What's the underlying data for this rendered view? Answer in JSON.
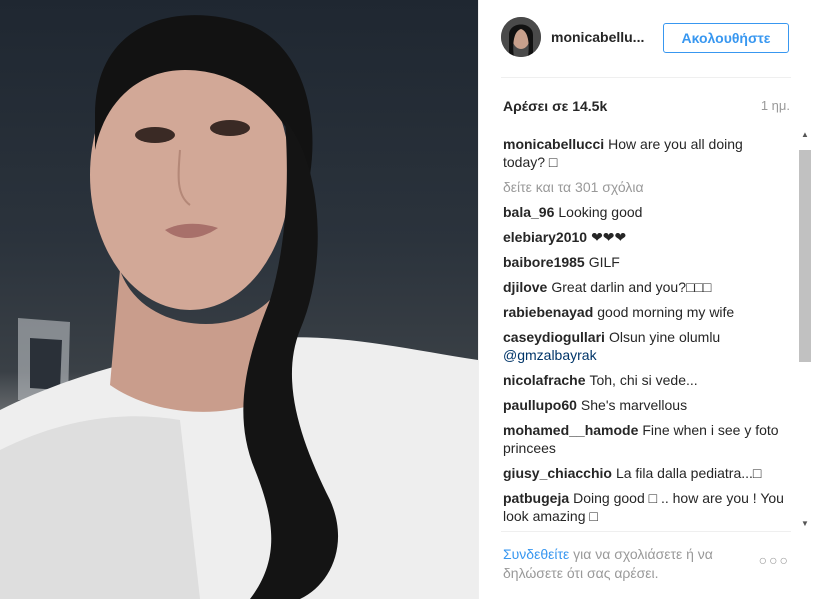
{
  "post": {
    "username": "monicabellu...",
    "follow_label": "Ακολουθήστε",
    "likes_label": "Αρέσει σε 14.5k",
    "time_ago": "1 ημ."
  },
  "comments": [
    {
      "user": "monicabellucci",
      "text": "How are you all doing today? □"
    },
    {
      "more": "δείτε και τα 301 σχόλια"
    },
    {
      "user": "bala_96",
      "text": "Looking good"
    },
    {
      "user": "elebiary2010",
      "text": "❤❤❤"
    },
    {
      "user": "baibore1985",
      "text": "GILF"
    },
    {
      "user": "djilove",
      "text": "Great darlin and you?□□□"
    },
    {
      "user": "rabiebenayad",
      "text": "good morning my wife"
    },
    {
      "user": "caseydiogullari",
      "text": "Olsun yine olumlu",
      "mention": "@gmzalbayrak"
    },
    {
      "user": "nicolafrache",
      "text": "Toh, chi si vede..."
    },
    {
      "user": "paullupo60",
      "text": "She's marvellous"
    },
    {
      "user": "mohamed__hamode",
      "text": "Fine when i see y foto princees"
    },
    {
      "user": "giusy_chiacchio",
      "text": "La fila dalla pediatra...□"
    },
    {
      "user": "patbugeja",
      "text": "Doing good □ .. how are you ! You look amazing □"
    }
  ],
  "footer": {
    "login_link": "Συνδεθείτε",
    "login_text": " για να σχολιάσετε ή να δηλώσετε ότι σας αρέσει.",
    "more_icon": "○○○"
  },
  "icons": {
    "scroll_up": "▲",
    "scroll_down": "▼"
  }
}
